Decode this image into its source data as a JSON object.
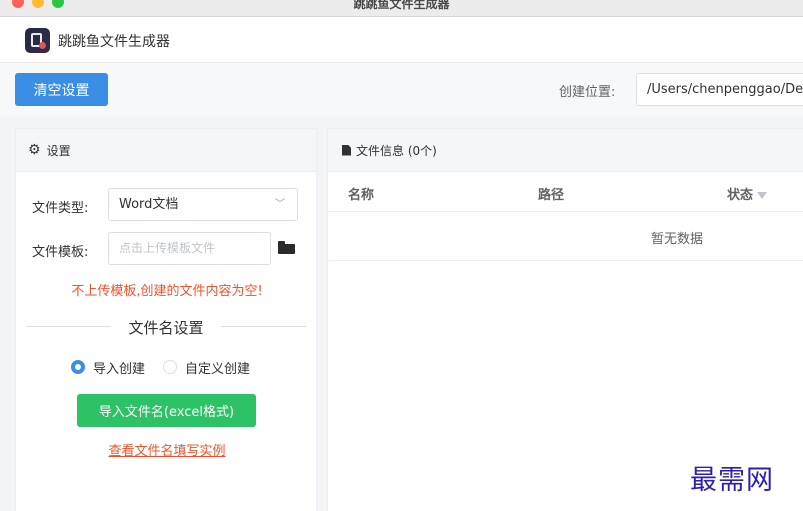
{
  "window": {
    "title": "跳跳鱼文件生成器"
  },
  "header": {
    "app_name": "跳跳鱼文件生成器"
  },
  "toolbar": {
    "clear_label": "清空设置",
    "location_label": "创建位置:",
    "location_value": "/Users/chenpenggao/De"
  },
  "settings": {
    "title": "设置",
    "file_type_label": "文件类型:",
    "file_type_value": "Word文档",
    "template_label": "文件模板:",
    "template_placeholder": "点击上传模板文件",
    "warning": "不上传模板,创建的文件内容为空!",
    "filename_section": "文件名设置",
    "radio_import": "导入创建",
    "radio_custom": "自定义创建",
    "import_button": "导入文件名(excel格式)",
    "example_link": "查看文件名填写实例"
  },
  "file_info": {
    "title": "文件信息 (0个)",
    "columns": [
      "名称",
      "路径",
      "状态"
    ],
    "empty_text": "暂无数据"
  },
  "watermark": "最需网",
  "colors": {
    "primary": "#3a8ee6",
    "success": "#2ec267",
    "warning_text": "#f0512b",
    "watermark": "#2a1fb0"
  },
  "icons": [
    "gear-icon",
    "file-icon",
    "folder-icon",
    "chevron-down-icon",
    "filter-icon"
  ]
}
